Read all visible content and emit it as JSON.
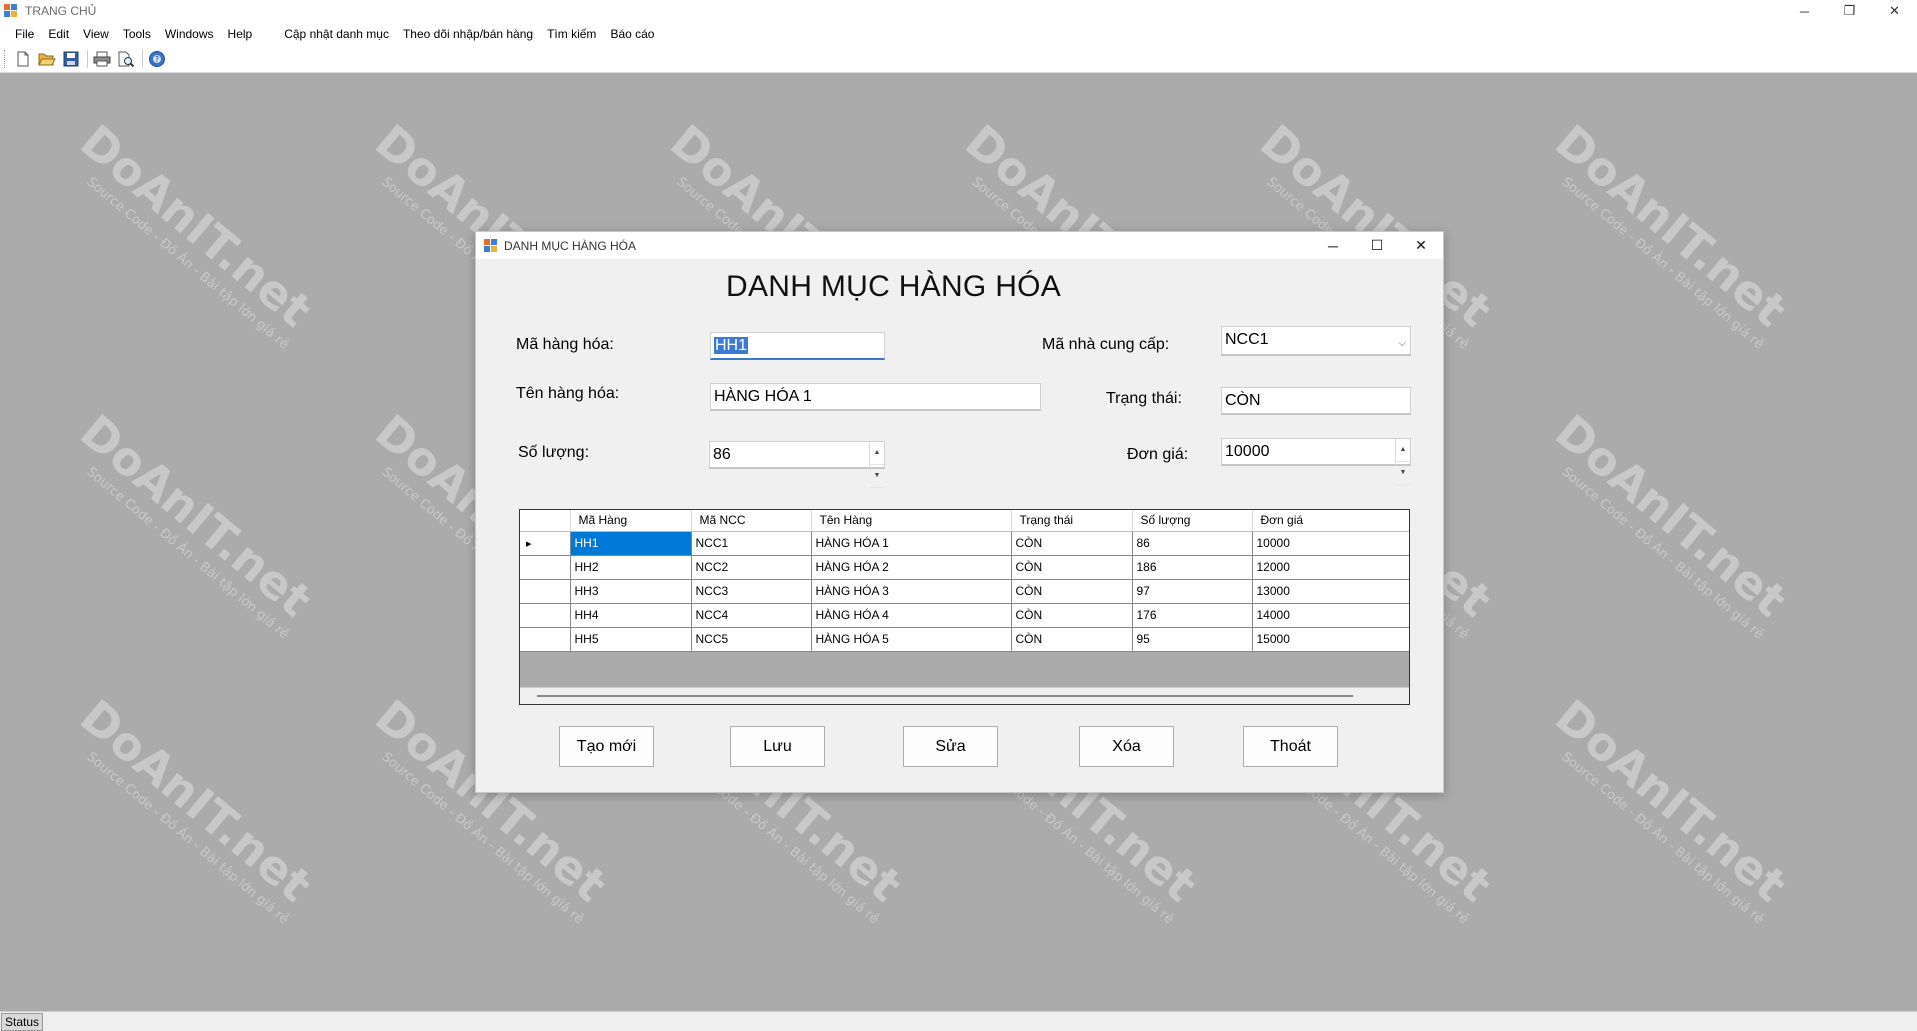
{
  "main_window": {
    "title": "TRANG CHỦ",
    "controls": [
      "─",
      "❐",
      "✕"
    ]
  },
  "menu": [
    "File",
    "Edit",
    "View",
    "Tools",
    "Windows",
    "Help",
    "Cập nhật danh mục",
    "Theo dõi nhập/bán hàng",
    "Tìm kiếm",
    "Báo cáo"
  ],
  "toolbar_icons": [
    "new-file-icon",
    "open-folder-icon",
    "save-icon",
    "print-icon",
    "print-preview-icon",
    "help-icon"
  ],
  "watermark": {
    "brand": "DoAnIT.net",
    "tagline": "Source Code - Đồ Án - Bài tập lớn giá rẻ"
  },
  "status": {
    "label": "Status"
  },
  "dialog": {
    "title": "DANH MỤC HÀNG HÓA",
    "heading": "DANH MỤC HÀNG HÓA",
    "labels": {
      "ma_hang": "Mã hàng hóa:",
      "ten_hang": "Tên hàng hóa:",
      "so_luong": "Số lượng:",
      "ma_ncc": "Mã nhà cung cấp:",
      "trang_thai": "Trạng thái:",
      "don_gia": "Đơn giá:"
    },
    "values": {
      "ma_hang": "HH1",
      "ten_hang": "HÀNG HÓA 1",
      "so_luong": "86",
      "ma_ncc": "NCC1",
      "trang_thai": "CÒN",
      "don_gia": "10000"
    },
    "grid": {
      "columns": [
        "Mã Hàng",
        "Mã NCC",
        "Tên Hàng",
        "Trạng thái",
        "Số lượng",
        "Đơn giá"
      ],
      "rows": [
        [
          "HH1",
          "NCC1",
          "HÀNG HÓA 1",
          "CÒN",
          "86",
          "10000"
        ],
        [
          "HH2",
          "NCC2",
          "HÀNG HÓA 2",
          "CÒN",
          "186",
          "12000"
        ],
        [
          "HH3",
          "NCC3",
          "HÀNG HÓA 3",
          "CÒN",
          "97",
          "13000"
        ],
        [
          "HH4",
          "NCC4",
          "HÀNG HÓA 4",
          "CÒN",
          "176",
          "14000"
        ],
        [
          "HH5",
          "NCC5",
          "HÀNG HÓA 5",
          "CÒN",
          "95",
          "15000"
        ]
      ],
      "current_row_marker": "▸"
    },
    "buttons": {
      "tao_moi": "Tạo mới",
      "luu": "Lưu",
      "sua": "Sửa",
      "xoa": "Xóa",
      "thoat": "Thoát"
    }
  },
  "colors": {
    "selection": "#0078d7",
    "mdi_background": "#ababab"
  }
}
